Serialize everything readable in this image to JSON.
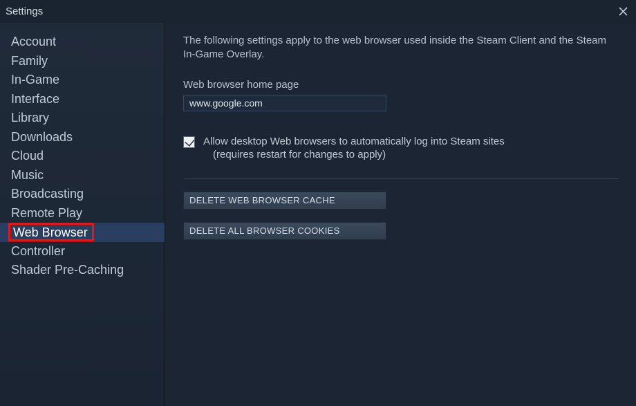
{
  "window": {
    "title": "Settings"
  },
  "sidebar": {
    "items": [
      {
        "label": "Account"
      },
      {
        "label": "Family"
      },
      {
        "label": "In-Game"
      },
      {
        "label": "Interface"
      },
      {
        "label": "Library"
      },
      {
        "label": "Downloads"
      },
      {
        "label": "Cloud"
      },
      {
        "label": "Music"
      },
      {
        "label": "Broadcasting"
      },
      {
        "label": "Remote Play"
      },
      {
        "label": "Web Browser"
      },
      {
        "label": "Controller"
      },
      {
        "label": "Shader Pre-Caching"
      }
    ],
    "selected_index": 10
  },
  "main": {
    "description": "The following settings apply to the web browser used inside the Steam Client and the Steam In-Game Overlay.",
    "homepage_label": "Web browser home page",
    "homepage_value": "www.google.com",
    "allow_auto_login": {
      "checked": true,
      "line1": "Allow desktop Web browsers to automatically log into Steam sites",
      "line2": "(requires restart for changes to apply)"
    },
    "buttons": {
      "delete_cache": "DELETE WEB BROWSER CACHE",
      "delete_cookies": "DELETE ALL BROWSER COOKIES"
    }
  }
}
